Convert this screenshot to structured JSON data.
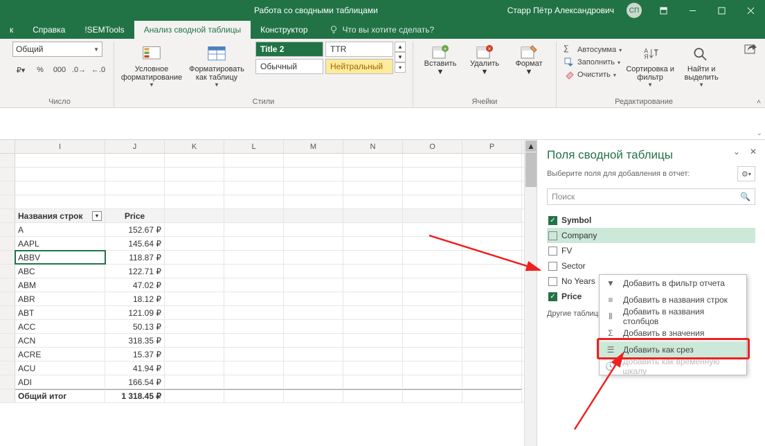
{
  "titlebar": {
    "context_title": "Работа со сводными таблицами",
    "user": "Старр Пётр Александрович",
    "avatar": "СП"
  },
  "tabs": {
    "t0": "к",
    "t1": "Справка",
    "t2": "!SEMTools",
    "t3": "Анализ сводной таблицы",
    "t4": "Конструктор",
    "tellme": "Что вы хотите сделать?"
  },
  "ribbon": {
    "number": {
      "format": "Общий",
      "label": "Число"
    },
    "styles": {
      "cond_fmt": "Условное форматирование",
      "fmt_table": "Форматировать как таблицу",
      "s1": "Title 2",
      "s2": "TTR",
      "s3": "Обычный",
      "s4": "Нейтральный",
      "label": "Стили"
    },
    "cells": {
      "insert": "Вставить",
      "delete": "Удалить",
      "format": "Формат",
      "label": "Ячейки"
    },
    "editing": {
      "autosum": "Автосумма",
      "fill": "Заполнить",
      "clear": "Очистить",
      "sort": "Сортировка и фильтр",
      "find": "Найти и выделить",
      "label": "Редактирование"
    }
  },
  "columns": {
    "I": "I",
    "J": "J",
    "K": "K",
    "L": "L",
    "M": "M",
    "N": "N",
    "O": "O",
    "P": "P"
  },
  "pivot_table": {
    "header_rows": "Названия строк",
    "header_price": "Price",
    "rows": [
      {
        "name": "A",
        "price": "152.67 ₽"
      },
      {
        "name": "AAPL",
        "price": "145.64 ₽"
      },
      {
        "name": "ABBV",
        "price": "118.87 ₽"
      },
      {
        "name": "ABC",
        "price": "122.71 ₽"
      },
      {
        "name": "ABM",
        "price": "47.02 ₽"
      },
      {
        "name": "ABR",
        "price": "18.12 ₽"
      },
      {
        "name": "ABT",
        "price": "121.09 ₽"
      },
      {
        "name": "ACC",
        "price": "50.13 ₽"
      },
      {
        "name": "ACN",
        "price": "318.35 ₽"
      },
      {
        "name": "ACRE",
        "price": "15.37 ₽"
      },
      {
        "name": "ACU",
        "price": "41.94 ₽"
      },
      {
        "name": "ADI",
        "price": "166.54 ₽"
      }
    ],
    "total_label": "Общий итог",
    "total_value": "1 318.45 ₽"
  },
  "pivotpane": {
    "title": "Поля сводной таблицы",
    "subtitle": "Выберите поля для добавления в отчет:",
    "search_placeholder": "Поиск",
    "fields": [
      {
        "label": "Symbol",
        "checked": true
      },
      {
        "label": "Company",
        "checked": false,
        "context": true
      },
      {
        "label": "FV",
        "checked": false
      },
      {
        "label": "Sector",
        "checked": false
      },
      {
        "label": "No Years",
        "checked": false
      },
      {
        "label": "Price",
        "checked": true
      }
    ],
    "other_tables": "Другие таблицы..."
  },
  "contextmenu": {
    "i1": "Добавить в фильтр отчета",
    "i2": "Добавить в названия строк",
    "i3": "Добавить в названия столбцов",
    "i4": "Добавить в значения",
    "i5": "Добавить как срез",
    "i6": "Добавить как временную шкалу"
  }
}
